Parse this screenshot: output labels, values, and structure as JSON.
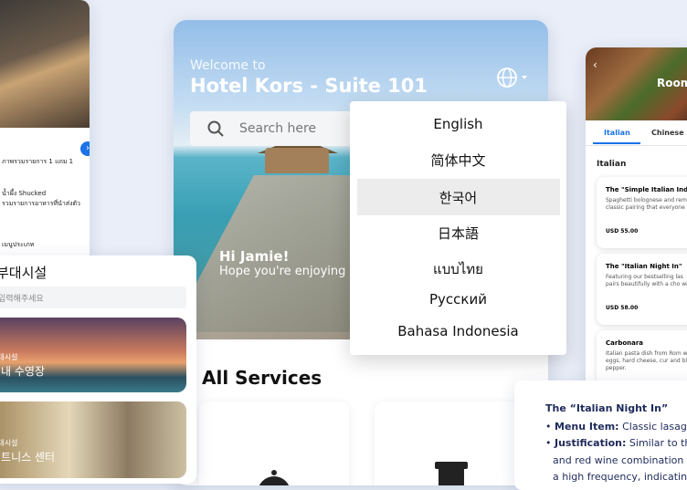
{
  "header": {
    "welcome": "Welcome to",
    "hotel_name": "Hotel Kors - Suite 101",
    "search_placeholder": "Search here",
    "greeting": "Hi Jamie!",
    "greeting_sub": "Hope you're enjoying"
  },
  "languages": [
    "English",
    "简体中文",
    "한국어",
    "日本語",
    "แบบไทย",
    "Русский",
    "Bahasa Indonesia"
  ],
  "selected_language": "한국어",
  "services_title": "All Services",
  "left_bar": {
    "line1": "ภาพรวมรายการ 1 แถม 1",
    "line2": "น้ำผึ้ง Shucked",
    "line3": "รวมรายการอาหารที่นำส่งตัว",
    "line4": "เมนูประเภท"
  },
  "korean_card": {
    "title": "부대시설",
    "search_placeholder": "입력해주세요",
    "item1_small": "부대시설",
    "item1_title": "실내 수영장",
    "item2_small": "부대시설",
    "item2_title": "피트니스 센터"
  },
  "menu_phone": {
    "header": "Room",
    "tabs": [
      "Italian",
      "Chinese"
    ],
    "section": "Italian",
    "items": [
      {
        "title": "The \"Simple Italian Indu",
        "desc": "Spaghetti bolognese and reme classic pairing that everyone",
        "price": "USD 55.00"
      },
      {
        "title": "The \"Italian Night In\"",
        "desc": "Featuring our bestselling las pairs beautifully with a cho wine.",
        "price": "USD 58.00"
      },
      {
        "title": "Carbonara",
        "desc": "Italian pasta dish from Rom with eggs, hard cheese, cur and black pepper.",
        "price": ""
      }
    ]
  },
  "note": {
    "title": "The “Italian Night In”",
    "menu_label": "Menu Item:",
    "menu_value": "Classic lasagna",
    "just_label": "Justification:",
    "just_value": "Similar to the",
    "line3": "and red wine combination",
    "line4": "a high frequency, indicatin"
  },
  "colors": {
    "accent": "#1a73e8",
    "selected_row": "#ececec"
  }
}
